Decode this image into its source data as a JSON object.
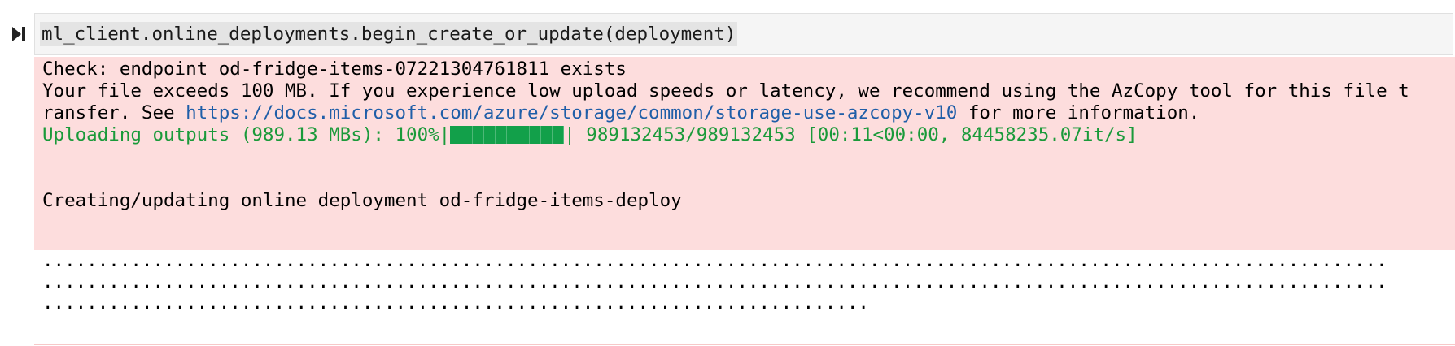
{
  "input": {
    "code": "ml_client.online_deployments.begin_create_or_update(deployment)"
  },
  "stderr": {
    "check_line": "Check: endpoint od-fridge-items-07221304761811 exists",
    "warn_line1": "Your file exceeds 100 MB. If you experience low upload speeds or latency, we recommend using the AzCopy tool for this file t",
    "warn_line2_prefix": "ransfer. See ",
    "warn_link": "https://docs.microsoft.com/azure/storage/common/storage-use-azcopy-v10",
    "warn_line2_suffix": " for more information.",
    "progress_prefix": "Uploading outputs (989.13 MBs): 100%|",
    "progress_percent": 100,
    "progress_suffix": "| 989132453/989132453 [00:11<00:00, 84458235.07it/s]",
    "creating_line": "Creating/updating online deployment od-fridge-items-deploy"
  },
  "stdout": {
    "dots_line1": "..........................................................................................................................",
    "dots_line2": "..........................................................................................................................",
    "dots_line3": "..........................................................................."
  },
  "colors": {
    "stderr_bg": "#fddddd",
    "link": "#1f5ea8",
    "progress_green": "#1a9a3a",
    "bar_fill": "#12a04a"
  },
  "icons": {
    "run": "run-cell-icon"
  }
}
